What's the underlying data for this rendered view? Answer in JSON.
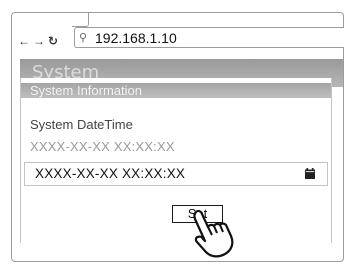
{
  "browser": {
    "nav": {
      "back_icon": "back-arrow-icon",
      "forward_icon": "forward-arrow-icon",
      "reload_icon": "reload-icon"
    },
    "address": {
      "search_icon": "search-icon",
      "url": "192.168.1.10"
    }
  },
  "page": {
    "section_title": "System",
    "panel": {
      "info_title": "System Information",
      "datetime_label": "System DateTime",
      "current_value": "XXXX-XX-XX XX:XX:XX",
      "input_value": "XXXX-XX-XX XX:XX:XX",
      "calendar_icon": "calendar-icon",
      "set_label": "Set"
    }
  },
  "overlay": {
    "cursor_icon": "pointing-hand-icon"
  },
  "colors": {
    "header_bar": "#a5a5a5",
    "header_text": "#dcdcdc",
    "border": "#c4c4c4"
  }
}
